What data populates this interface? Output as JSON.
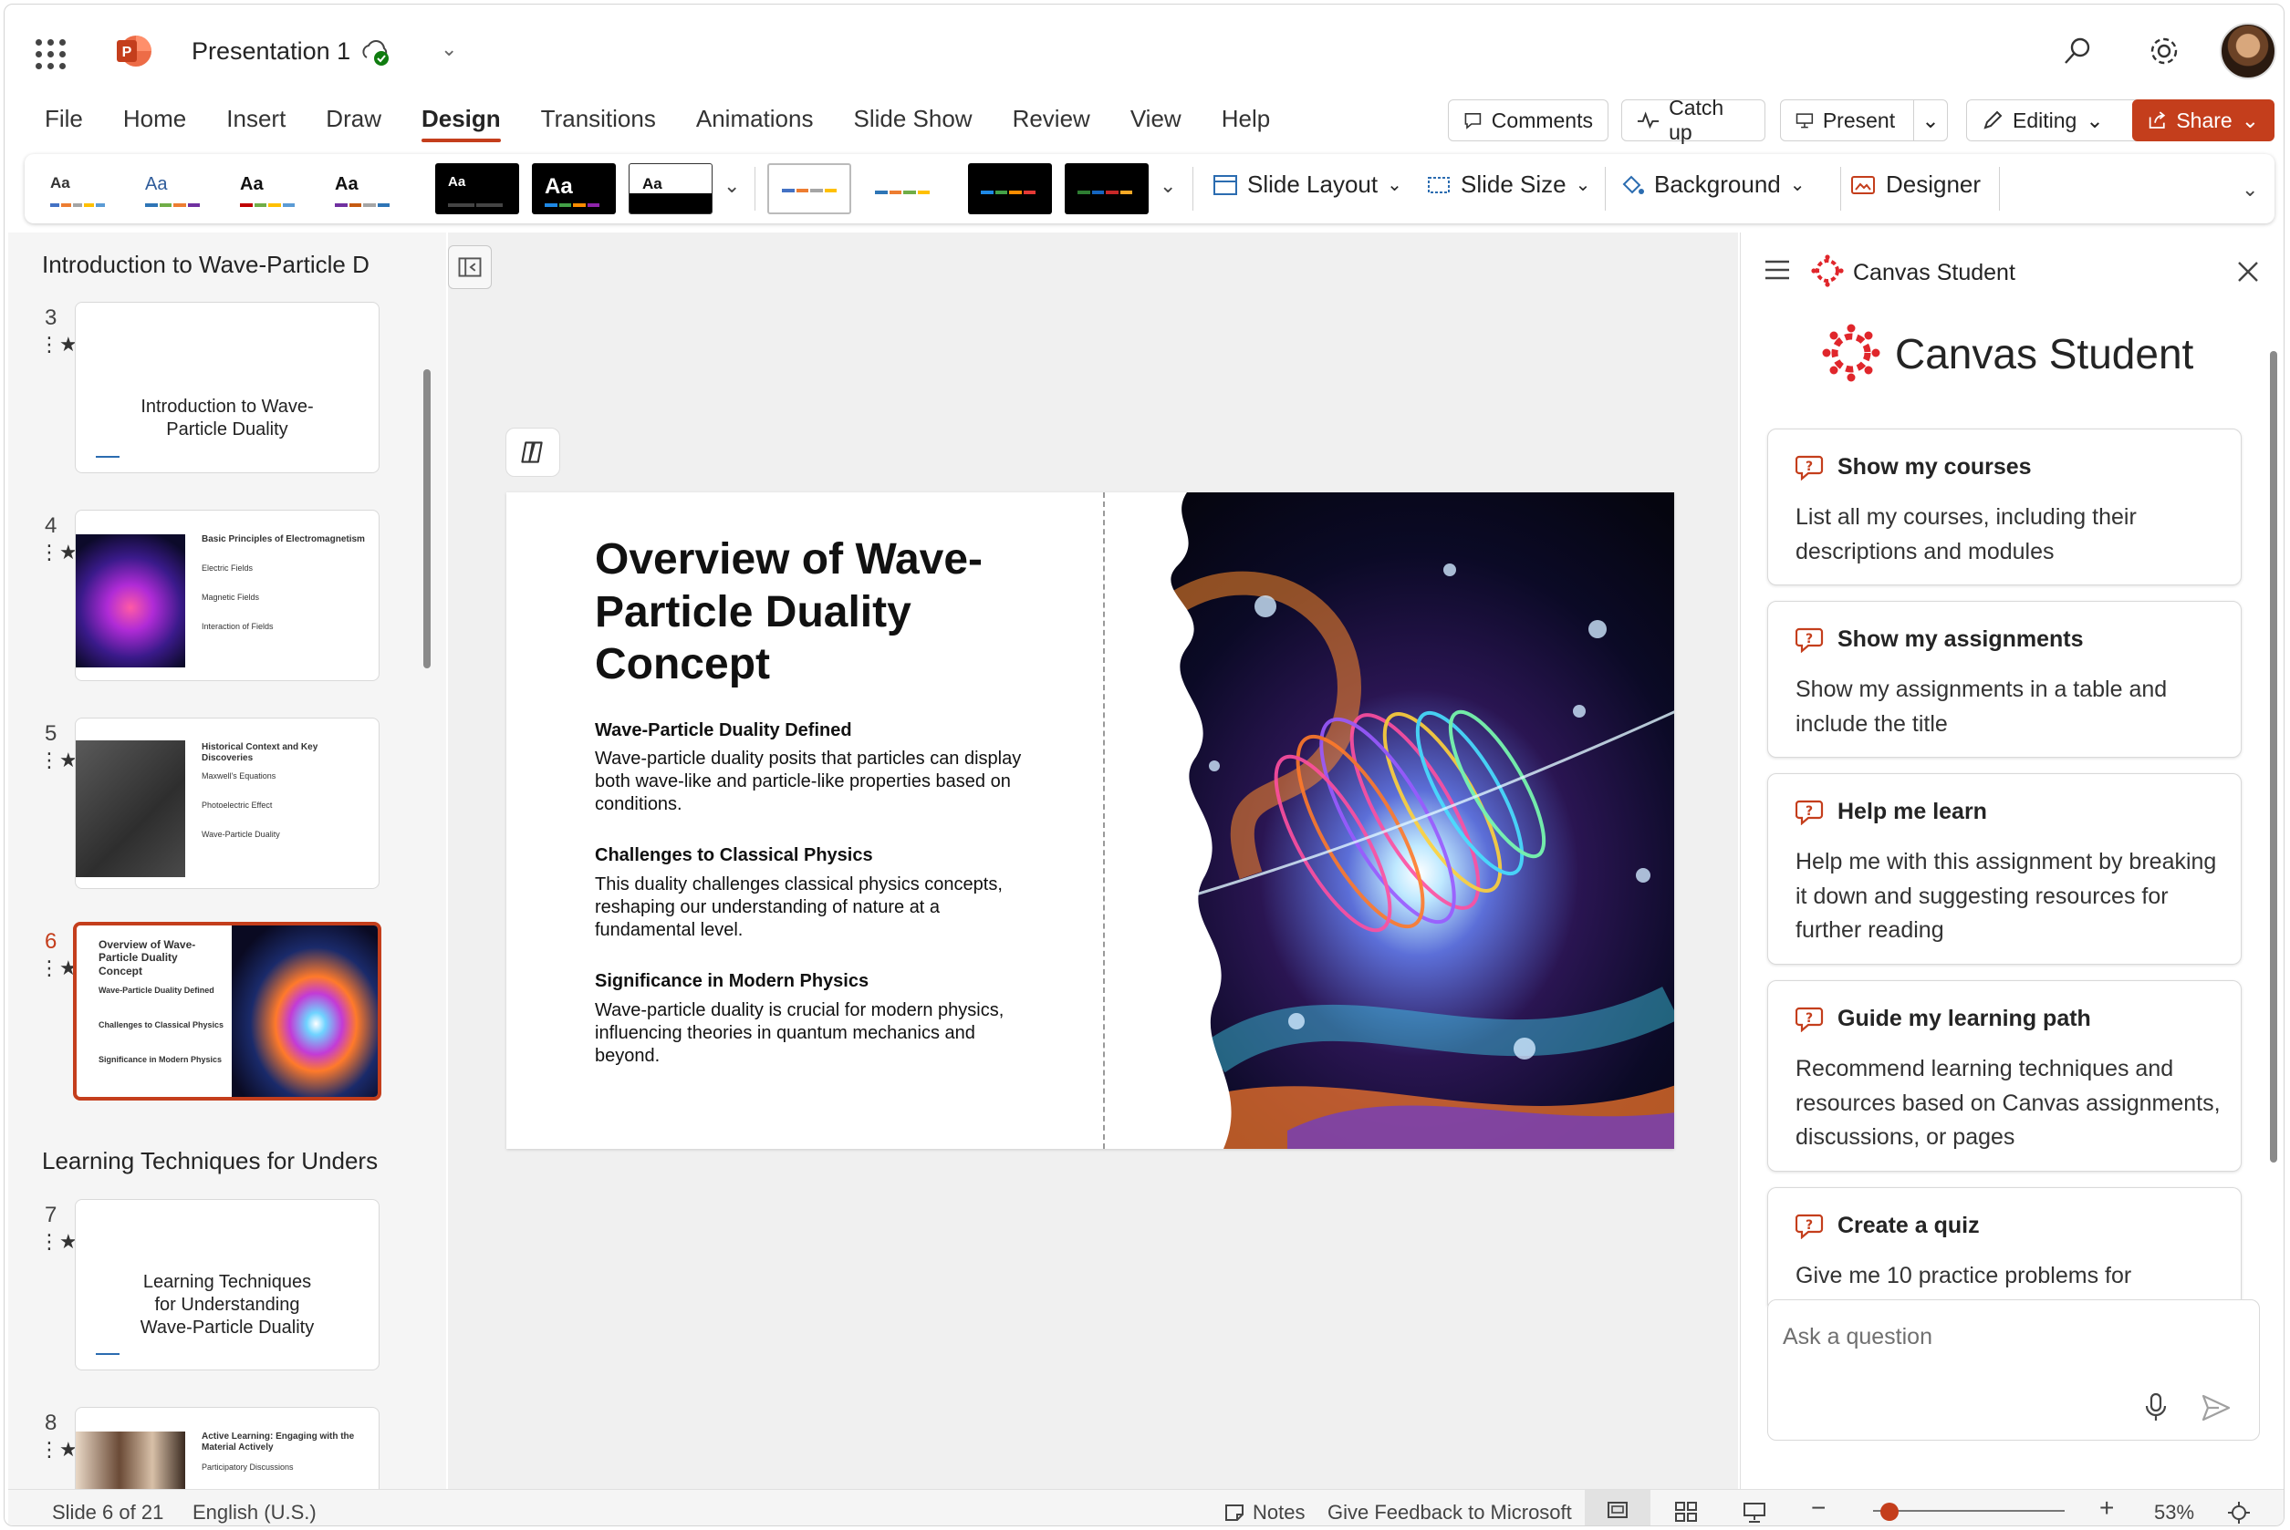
{
  "app": {
    "doc_title": "Presentation 1"
  },
  "menu": [
    "File",
    "Home",
    "Insert",
    "Draw",
    "Design",
    "Transitions",
    "Animations",
    "Slide Show",
    "Review",
    "View",
    "Help"
  ],
  "toolbar": {
    "comments": "Comments",
    "catch_up": "Catch up",
    "present": "Present",
    "editing": "Editing",
    "share": "Share"
  },
  "ribbon": {
    "theme_label": "Aa",
    "slide_layout": "Slide Layout",
    "slide_size": "Slide Size",
    "background": "Background",
    "designer": "Designer"
  },
  "thumbnails": {
    "section1": "Introduction to Wave-Particle D",
    "section2": "Learning Techniques for Unders",
    "slides": [
      {
        "num": "3",
        "title": "Introduction to Wave-\nParticle Duality"
      },
      {
        "num": "4",
        "title": "Basic Principles of Electromagnetism",
        "lines": [
          "Electric Fields",
          "Magnetic Fields",
          "Interaction of Fields"
        ]
      },
      {
        "num": "5",
        "title": "Historical Context and Key Discoveries",
        "lines": [
          "Maxwell's Equations",
          "Photoelectric Effect",
          "Wave-Particle Duality"
        ]
      },
      {
        "num": "6",
        "title": "Overview of Wave-Particle Duality Concept",
        "lines": [
          "Wave-Particle Duality Defined",
          "Challenges to Classical Physics",
          "Significance in Modern Physics"
        ]
      },
      {
        "num": "7",
        "title": "Learning Techniques\nfor Understanding\nWave-Particle Duality"
      },
      {
        "num": "8",
        "title": "Active Learning: Engaging with the Material Actively",
        "lines": [
          "Participatory Discussions"
        ]
      }
    ]
  },
  "slide": {
    "title": "Overview of Wave-Particle Duality Concept",
    "sections": [
      {
        "heading": "Wave-Particle Duality Defined",
        "body": "Wave-particle duality posits that particles can display both wave-like and particle-like properties based on conditions."
      },
      {
        "heading": "Challenges to Classical Physics",
        "body": "This duality challenges classical physics concepts, reshaping our understanding of nature at a fundamental level."
      },
      {
        "heading": "Significance in Modern Physics",
        "body": "Wave-particle duality is crucial for modern physics, influencing theories in quantum mechanics and beyond."
      }
    ]
  },
  "canvas_pane": {
    "header": "Canvas Student",
    "title": "Canvas Student",
    "cards": [
      {
        "title": "Show my courses",
        "body": "List all my courses, including their descriptions and modules"
      },
      {
        "title": "Show my assignments",
        "body": "Show my assignments in a table and include the title"
      },
      {
        "title": "Help me learn",
        "body": "Help me with this assignment by breaking it down and suggesting resources for further reading"
      },
      {
        "title": "Guide my learning path",
        "body": "Recommend learning techniques and resources based on Canvas assignments, discussions, or pages"
      },
      {
        "title": "Create a quiz",
        "body": "Give me 10 practice problems for"
      }
    ],
    "ask_placeholder": "Ask a question"
  },
  "status": {
    "slide_pos": "Slide 6 of 21",
    "language": "English (U.S.)",
    "notes": "Notes",
    "feedback": "Give Feedback to Microsoft",
    "zoom": "53%"
  },
  "colors": {
    "accent": "#c43e1c",
    "canvas_red": "#e0262b"
  }
}
